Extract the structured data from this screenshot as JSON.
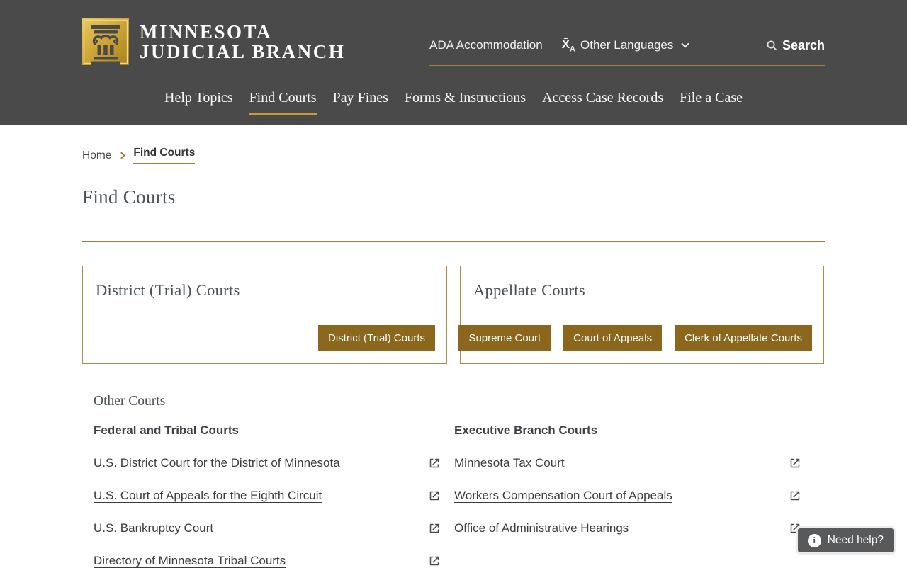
{
  "header": {
    "brand": {
      "line1": "MINNESOTA",
      "line2": "JUDICIAL BRANCH",
      "logo_icon": "column-pillar-icon"
    },
    "utility": {
      "ada_label": "ADA Accommodation",
      "languages_label": "Other Languages",
      "languages_icon": "translate-icon",
      "search_label": "Search",
      "search_icon": "search-icon"
    },
    "nav": [
      {
        "label": "Help Topics",
        "active": false
      },
      {
        "label": "Find Courts",
        "active": true
      },
      {
        "label": "Pay Fines",
        "active": false
      },
      {
        "label": "Forms & Instructions",
        "active": false
      },
      {
        "label": "Access Case Records",
        "active": false
      },
      {
        "label": "File a Case",
        "active": false
      }
    ]
  },
  "breadcrumb": {
    "home": "Home",
    "current": "Find Courts"
  },
  "page": {
    "title": "Find Courts"
  },
  "cards": [
    {
      "title": "District (Trial) Courts",
      "buttons": [
        "District (Trial) Courts"
      ]
    },
    {
      "title": "Appellate Courts",
      "buttons": [
        "Supreme Court",
        "Court of Appeals",
        "Clerk of Appellate Courts"
      ]
    }
  ],
  "other_courts": {
    "title": "Other Courts",
    "columns": [
      {
        "header": "Federal and Tribal Courts",
        "links": [
          "U.S. District Court for the District of Minnesota",
          "U.S. Court of Appeals for the Eighth Circuit",
          "U.S. Bankruptcy Court",
          "Directory of Minnesota Tribal Courts"
        ]
      },
      {
        "header": "Executive Branch Courts",
        "links": [
          "Minnesota Tax Court",
          "Workers Compensation Court of Appeals",
          "Office of Administrative Hearings"
        ]
      }
    ],
    "link_icon": "external-link-icon"
  },
  "help_button": {
    "label": "Need help?",
    "icon": "info-icon"
  },
  "colors": {
    "header_background": "#4a4a4b",
    "gold_accent": "#9c8034",
    "button_gold": "#8a671c",
    "card_border": "#aa8e44",
    "logo_gold_light": "#e2bf50",
    "logo_gold_dark": "#ab851f",
    "heading_text": "#4a5157",
    "body_text": "#3c3c3c",
    "help_button_background": "#58595b"
  }
}
